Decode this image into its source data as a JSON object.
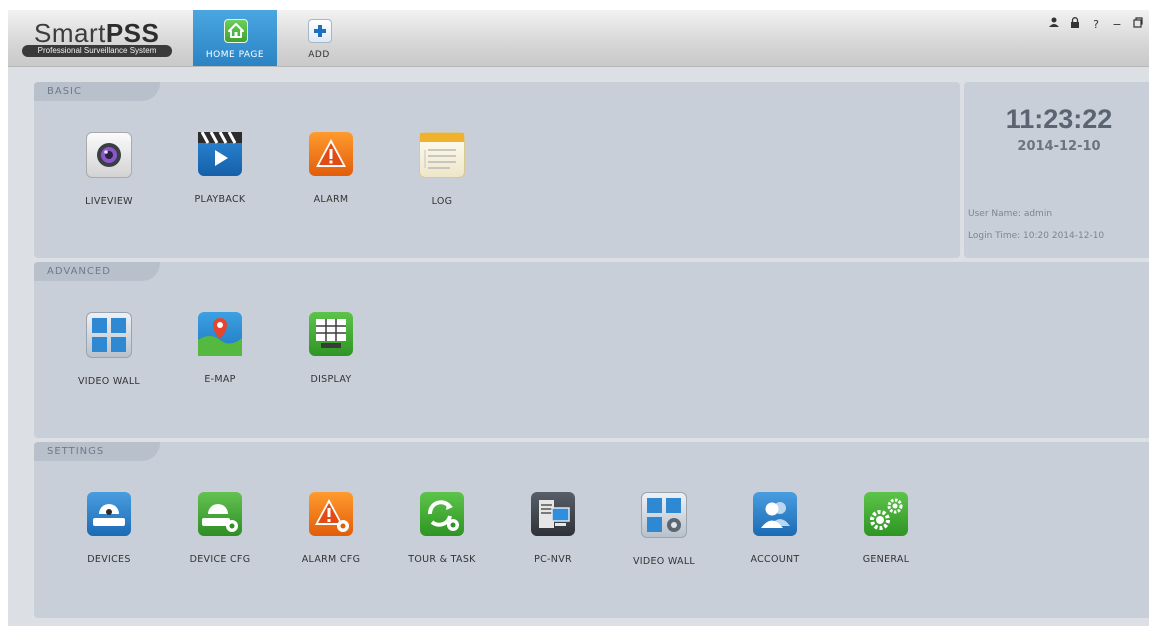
{
  "header": {
    "brand_title_a": "Smart",
    "brand_title_b": "PSS",
    "brand_subtitle": "Professional Surveillance System",
    "tabs": [
      {
        "label": "HOME PAGE",
        "icon": "home-icon",
        "active": true
      },
      {
        "label": "ADD",
        "icon": "plus-icon",
        "active": false
      }
    ],
    "controls": [
      "user-icon",
      "lock-icon",
      "help-icon",
      "minimize-icon",
      "restore-icon"
    ],
    "help_glyph": "?",
    "min_glyph": "−"
  },
  "basic": {
    "title": "BASIC",
    "items": [
      {
        "label": "LIVEVIEW",
        "icon": "camera-lens-icon"
      },
      {
        "label": "PLAYBACK",
        "icon": "clapper-play-icon"
      },
      {
        "label": "ALARM",
        "icon": "warning-icon"
      },
      {
        "label": "LOG",
        "icon": "notepad-icon"
      }
    ]
  },
  "info": {
    "clock": "11:23:22",
    "date": "2014-12-10",
    "user": "User Name: admin",
    "login": "Login Time: 10:20 2014-12-10"
  },
  "advanced": {
    "title": "ADVANCED",
    "items": [
      {
        "label": "VIDEO WALL",
        "icon": "video-wall-icon"
      },
      {
        "label": "E-MAP",
        "icon": "map-pin-icon"
      },
      {
        "label": "DISPLAY",
        "icon": "display-grid-icon"
      }
    ]
  },
  "settings": {
    "title": "SETTINGS",
    "items": [
      {
        "label": "DEVICES",
        "icon": "dome-camera-icon"
      },
      {
        "label": "DEVICE CFG",
        "icon": "dome-camera-gear-icon"
      },
      {
        "label": "ALARM CFG",
        "icon": "warning-gear-icon"
      },
      {
        "label": "TOUR & TASK",
        "icon": "cycle-gear-icon"
      },
      {
        "label": "PC-NVR",
        "icon": "pc-nvr-icon"
      },
      {
        "label": "VIDEO WALL",
        "icon": "video-wall-gear-icon"
      },
      {
        "label": "ACCOUNT",
        "icon": "users-icon"
      },
      {
        "label": "GENERAL",
        "icon": "gears-icon"
      }
    ]
  },
  "colors": {
    "accent": "#2b83c4",
    "panel": "#c9cfd9",
    "background": "#dcdfe4"
  }
}
